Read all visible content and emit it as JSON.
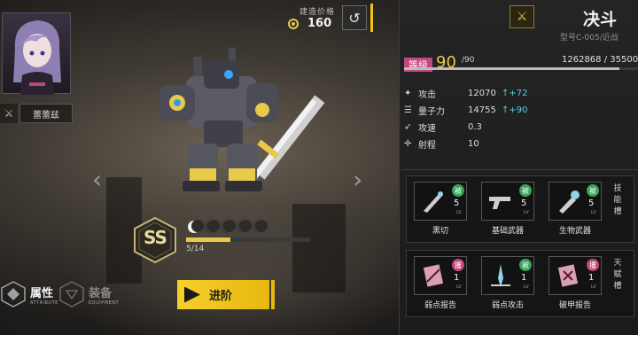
{
  "character": {
    "name": "蕾蕾兹",
    "icon": "crossed-weapons-icon"
  },
  "build_cost": {
    "label": "建造价格",
    "value": "160",
    "icon": "coin-icon"
  },
  "unit": {
    "name": "决斗",
    "model": "型号C-005/近战",
    "level_label": "等级",
    "level": "90",
    "level_max": "/90",
    "exp": "1262868 / 35500",
    "exp_fill": 0.92
  },
  "stats": [
    {
      "icon": "attack-icon",
      "name": "攻击",
      "value": "12070",
      "bonus": "+72"
    },
    {
      "icon": "quantum-icon",
      "name": "量子力",
      "value": "14755",
      "bonus": "+90"
    },
    {
      "icon": "speed-icon",
      "name": "攻速",
      "value": "0.3",
      "bonus": ""
    },
    {
      "icon": "range-icon",
      "name": "射程",
      "value": "10",
      "bonus": ""
    }
  ],
  "rank": {
    "grade": "SS",
    "stars_total": 5,
    "stars_on": 1,
    "progress": "5/14",
    "progress_fraction": 0.357
  },
  "tabs": {
    "attribute": {
      "label": "属性",
      "sub": "ATTRIBUTE"
    },
    "equipment": {
      "label": "装备",
      "sub": "EQUIPMENT"
    }
  },
  "advance_button": {
    "label": "进阶"
  },
  "skills_label": "技能槽",
  "talents_label": "天赋槽",
  "lv_label": "LV",
  "skills": [
    {
      "name": "黑切",
      "badge": "被",
      "level": "5"
    },
    {
      "name": "基础武器",
      "badge": "被",
      "level": "5"
    },
    {
      "name": "生物武器",
      "badge": "被",
      "level": "5"
    }
  ],
  "talents": [
    {
      "name": "弱点报告",
      "badge": "攫",
      "level": "1"
    },
    {
      "name": "弱点攻击",
      "badge": "被",
      "level": "1"
    },
    {
      "name": "破甲报告",
      "badge": "攫",
      "level": "1"
    }
  ],
  "colors": {
    "accent": "#f1c40f",
    "level_tag": "#c2477a",
    "bonus": "#4fd3e8",
    "badge_green": "#3aa35a"
  }
}
